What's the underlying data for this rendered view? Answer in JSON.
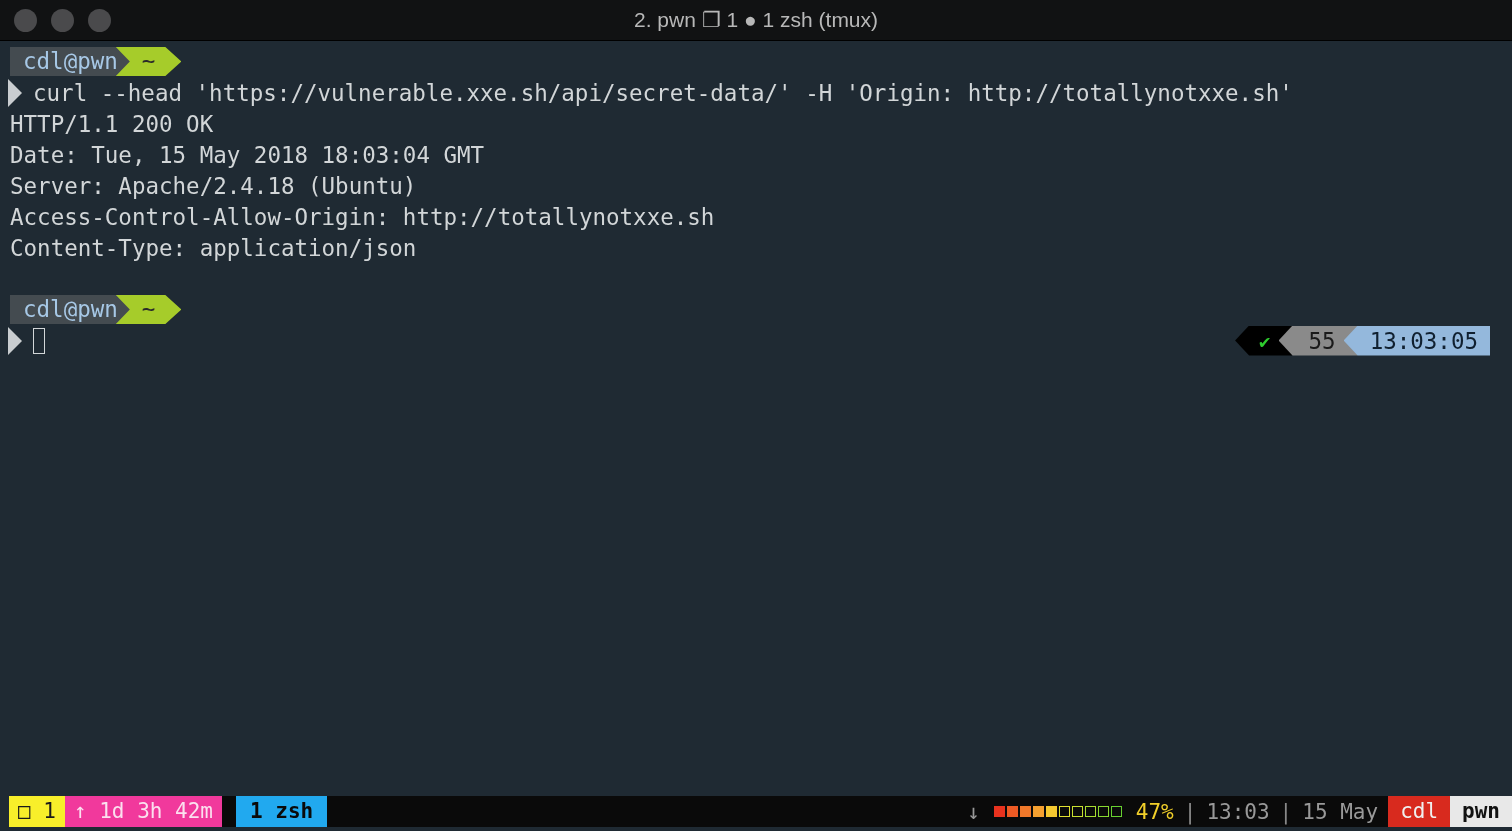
{
  "window": {
    "title": "2. pwn ❐ 1 ● 1 zsh (tmux)"
  },
  "terminal": {
    "lines": [
      {
        "kind": "prompt",
        "user": "cdl@pwn",
        "dir": "~"
      },
      {
        "kind": "command",
        "text": "curl --head 'https://vulnerable.xxe.sh/api/secret-data/' -H 'Origin: http://totallynotxxe.sh'"
      },
      {
        "kind": "output",
        "text": "HTTP/1.1 200 OK"
      },
      {
        "kind": "output",
        "text": "Date: Tue, 15 May 2018 18:03:04 GMT"
      },
      {
        "kind": "output",
        "text": "Server: Apache/2.4.18 (Ubuntu)"
      },
      {
        "kind": "output",
        "text": "Access-Control-Allow-Origin: http://totallynotxxe.sh"
      },
      {
        "kind": "output",
        "text": "Content-Type: application/json"
      },
      {
        "kind": "blank"
      },
      {
        "kind": "prompt",
        "user": "cdl@pwn",
        "dir": "~"
      },
      {
        "kind": "input",
        "cursor": true,
        "right_prompt": {
          "status": "✔",
          "number": "55",
          "time": "13:03:05"
        }
      }
    ]
  },
  "status_bar": {
    "left": [
      {
        "text": "□ 1",
        "color": "#f8ef2a"
      },
      {
        "text": "↑ 1d 3h 42m",
        "color": "#f1399c"
      }
    ],
    "windows": [
      {
        "label": "1 zsh",
        "selected": true
      }
    ],
    "right": [
      {
        "kind": "arrow",
        "text": "↓"
      },
      {
        "kind": "battery",
        "level": 0.47,
        "reading": "47%"
      },
      {
        "kind": "separator",
        "text": "|"
      },
      {
        "kind": "clock",
        "text": "13:03"
      },
      {
        "kind": "separator",
        "text": "|"
      },
      {
        "kind": "date",
        "text": "15 May"
      },
      {
        "kind": "user",
        "text": "cdl"
      },
      {
        "kind": "host",
        "text": "pwn"
      }
    ]
  }
}
